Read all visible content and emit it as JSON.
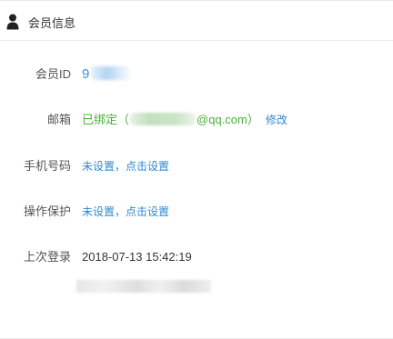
{
  "header": {
    "icon": "user-icon",
    "title": "会员信息"
  },
  "fields": {
    "member_id": {
      "label": "会员ID",
      "value_visible": "9"
    },
    "email": {
      "label": "邮箱",
      "status": "已绑定",
      "open_paren": "（",
      "domain": "@qq.com",
      "close_paren": "）",
      "action": "修改"
    },
    "phone": {
      "label": "手机号码",
      "value": "未设置，点击设置"
    },
    "protection": {
      "label": "操作保护",
      "value": "未设置，点击设置"
    },
    "last_login": {
      "label": "上次登录",
      "value": "2018-07-13 15:42:19"
    }
  },
  "colors": {
    "link_blue": "#3c8fd8",
    "bound_green": "#4caf3c",
    "label_gray": "#555555"
  }
}
